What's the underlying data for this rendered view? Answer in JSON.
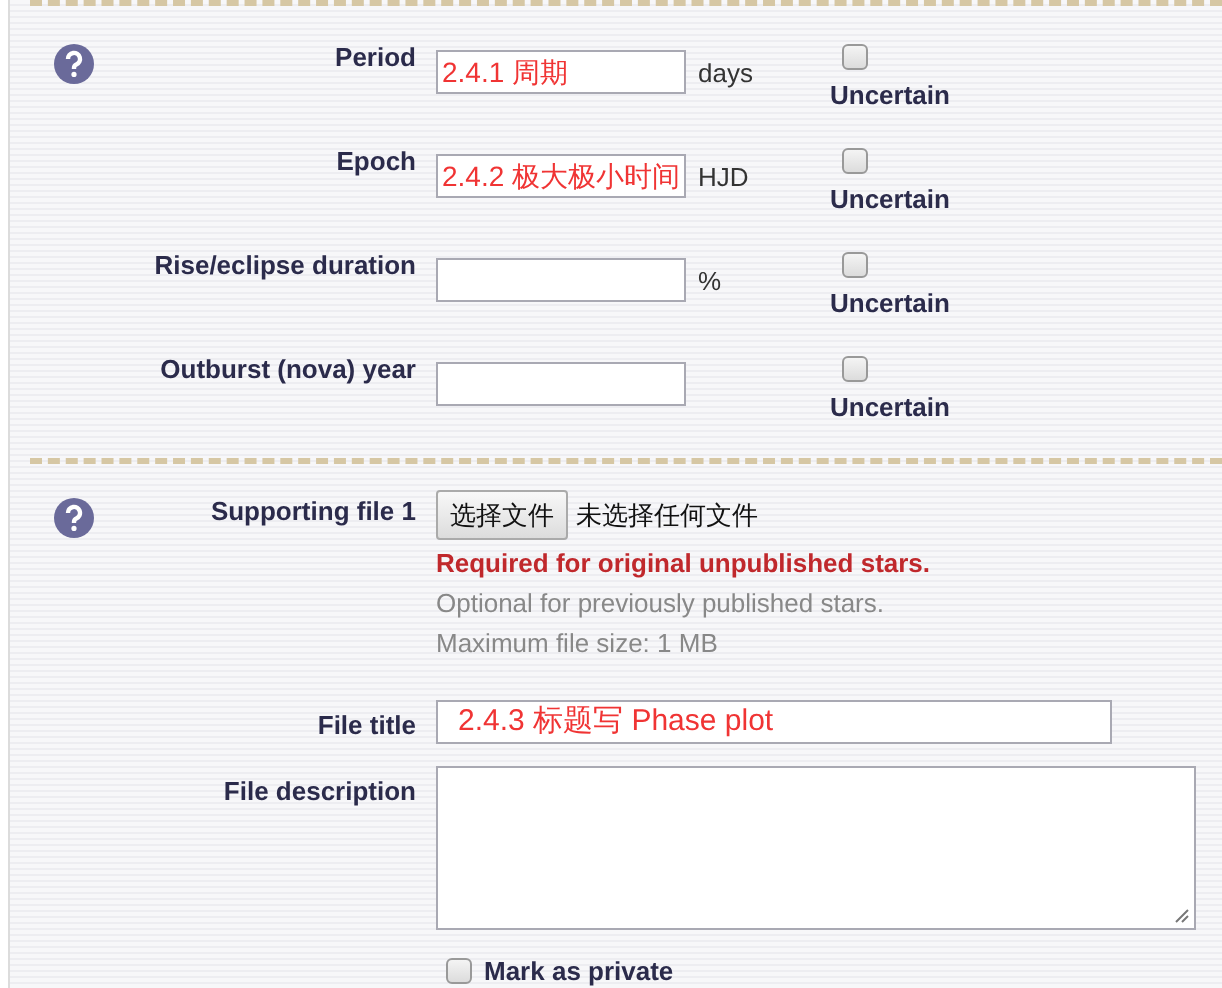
{
  "sections": [
    {
      "help": true,
      "rows": [
        {
          "kind": "measure",
          "label": "Period",
          "value": "2.4.1 周期",
          "unit": "days",
          "uncertain": {
            "label": "Uncertain",
            "checked": false
          }
        },
        {
          "kind": "measure",
          "label": "Epoch",
          "value": "2.4.2 极大极小时间",
          "unit": "HJD",
          "uncertain": {
            "label": "Uncertain",
            "checked": false
          }
        },
        {
          "kind": "measure",
          "label": "Rise/eclipse duration",
          "unit": "%",
          "uncertain": {
            "label": "Uncertain",
            "checked": false
          }
        },
        {
          "kind": "measure",
          "label": "Outburst (nova) year",
          "uncertain": {
            "label": "Uncertain",
            "checked": false
          }
        }
      ]
    },
    {
      "help": true,
      "rows": [
        {
          "kind": "file",
          "label": "Supporting file 1",
          "button": "选择文件",
          "status": "未选择任何文件",
          "notes": [
            {
              "kind": "required",
              "text": "Required for original unpublished stars."
            },
            {
              "kind": "hint",
              "text": "Optional for previously published stars."
            },
            {
              "kind": "hint",
              "text": "Maximum file size: 1 MB"
            }
          ]
        },
        {
          "kind": "text",
          "label": "File title",
          "value": "2.4.3 标题写 Phase plot"
        },
        {
          "kind": "textarea",
          "label": "File description"
        },
        {
          "kind": "checkbox",
          "label": "Mark as private",
          "checked": false
        }
      ]
    }
  ]
}
